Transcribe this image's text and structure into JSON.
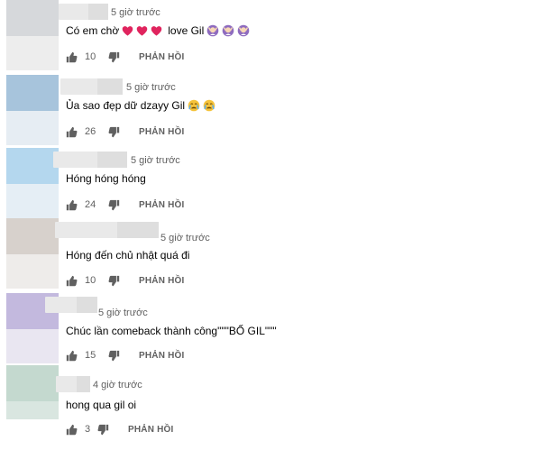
{
  "comments": [
    {
      "time": "5 giờ trước",
      "text": "Có em chờ",
      "suffix": "love Gil",
      "likes": "10",
      "reply_label": "PHẢN HỒI",
      "avatar_colors": [
        "#d6d8db",
        "#ededed"
      ]
    },
    {
      "time": "5 giờ trước",
      "text": "Ủa sao đẹp dữ dzayy Gil",
      "likes": "26",
      "reply_label": "PHẢN HỒI",
      "avatar_colors": [
        "#a7c4dc",
        "#e6edf3"
      ]
    },
    {
      "time": "5 giờ trước",
      "text": "Hóng hóng hóng",
      "likes": "24",
      "reply_label": "PHẢN HỒI",
      "avatar_colors": [
        "#b4d7ee",
        "#e5eef5"
      ]
    },
    {
      "time": "5 giờ trước",
      "text": "Hóng đến chủ nhật quá đi",
      "likes": "10",
      "reply_label": "PHẢN HỒI",
      "avatar_colors": [
        "#d7d1cc",
        "#eeecea"
      ]
    },
    {
      "time": "5 giờ trước",
      "text": "Chúc lần comeback thành công\"\"\"BỐ GIL\"\"\"",
      "likes": "15",
      "reply_label": "PHẢN HỒI",
      "avatar_colors": [
        "#c3b9de",
        "#e9e6f1"
      ]
    },
    {
      "time": "4 giờ trước",
      "text": "hong qua gil oi",
      "likes": "3",
      "reply_label": "PHẢN HỒI",
      "avatar_colors": [
        "#c4d9cf",
        "#d9e6e0"
      ]
    }
  ],
  "icons": {
    "like": "thumbs-up-icon",
    "dislike": "thumbs-down-icon",
    "heart": "red-heart-emoji",
    "crying": "crying-face-emoji",
    "woman": "woman-gesturing-emoji"
  },
  "colors": {
    "text": "#030303",
    "secondary": "#606060",
    "heart": "#e0245e",
    "emoji_purple": "#8e6bbf",
    "emoji_yellow": "#f5c33b"
  }
}
